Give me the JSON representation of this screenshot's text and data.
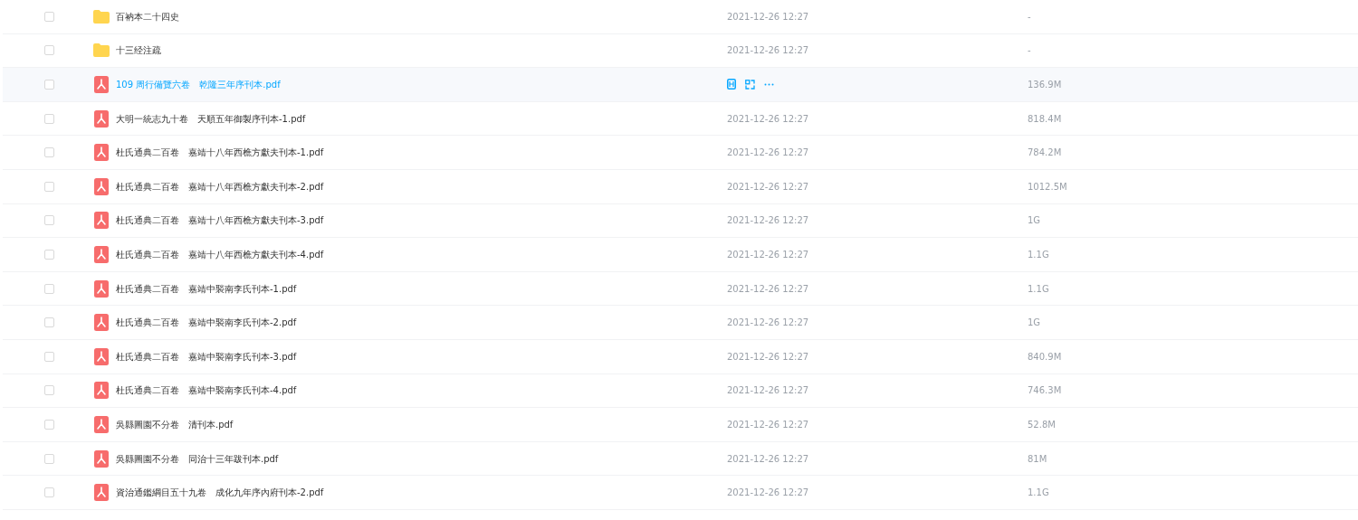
{
  "rows": [
    {
      "kind": "folder",
      "name": "百衲本二十四史",
      "date": "2021-12-26 12:27",
      "size": "-",
      "hovered": false,
      "checked": false
    },
    {
      "kind": "folder",
      "name": "十三经注疏",
      "date": "2021-12-26 12:27",
      "size": "-",
      "hovered": false,
      "checked": false
    },
    {
      "kind": "pdf",
      "name": "109 周行備覽六卷　乾隆三年序刊本.pdf",
      "size": "136.9M",
      "hovered": true,
      "checked": false
    },
    {
      "kind": "pdf",
      "name": "大明一統志九十卷　天順五年御製序刊本-1.pdf",
      "date": "2021-12-26 12:27",
      "size": "818.4M",
      "hovered": false,
      "checked": false
    },
    {
      "kind": "pdf",
      "name": "杜氏通典二百卷　嘉靖十八年西樵方獻夫刊本-1.pdf",
      "date": "2021-12-26 12:27",
      "size": "784.2M",
      "hovered": false,
      "checked": false
    },
    {
      "kind": "pdf",
      "name": "杜氏通典二百卷　嘉靖十八年西樵方獻夫刊本-2.pdf",
      "date": "2021-12-26 12:27",
      "size": "1012.5M",
      "hovered": false,
      "checked": false
    },
    {
      "kind": "pdf",
      "name": "杜氏通典二百卷　嘉靖十八年西樵方獻夫刊本-3.pdf",
      "date": "2021-12-26 12:27",
      "size": "1G",
      "hovered": false,
      "checked": false
    },
    {
      "kind": "pdf",
      "name": "杜氏通典二百卷　嘉靖十八年西樵方獻夫刊本-4.pdf",
      "date": "2021-12-26 12:27",
      "size": "1.1G",
      "hovered": false,
      "checked": false
    },
    {
      "kind": "pdf",
      "name": "杜氏通典二百卷　嘉靖中褧南李氏刊本-1.pdf",
      "date": "2021-12-26 12:27",
      "size": "1.1G",
      "hovered": false,
      "checked": false
    },
    {
      "kind": "pdf",
      "name": "杜氏通典二百卷　嘉靖中褧南李氏刊本-2.pdf",
      "date": "2021-12-26 12:27",
      "size": "1G",
      "hovered": false,
      "checked": false
    },
    {
      "kind": "pdf",
      "name": "杜氏通典二百卷　嘉靖中褧南李氏刊本-3.pdf",
      "date": "2021-12-26 12:27",
      "size": "840.9M",
      "hovered": false,
      "checked": false
    },
    {
      "kind": "pdf",
      "name": "杜氏通典二百卷　嘉靖中褧南李氏刊本-4.pdf",
      "date": "2021-12-26 12:27",
      "size": "746.3M",
      "hovered": false,
      "checked": false
    },
    {
      "kind": "pdf",
      "name": "吳縣圖園不分卷　清刊本.pdf",
      "date": "2021-12-26 12:27",
      "size": "52.8M",
      "hovered": false,
      "checked": false
    },
    {
      "kind": "pdf",
      "name": "吳縣圖園不分卷　同治十三年跋刊本.pdf",
      "date": "2021-12-26 12:27",
      "size": "81M",
      "hovered": false,
      "checked": false
    },
    {
      "kind": "pdf",
      "name": "資治通鑑綱目五十九卷　成化九年序內府刊本-2.pdf",
      "date": "2021-12-26 12:27",
      "size": "1.1G",
      "hovered": false,
      "checked": false
    }
  ]
}
